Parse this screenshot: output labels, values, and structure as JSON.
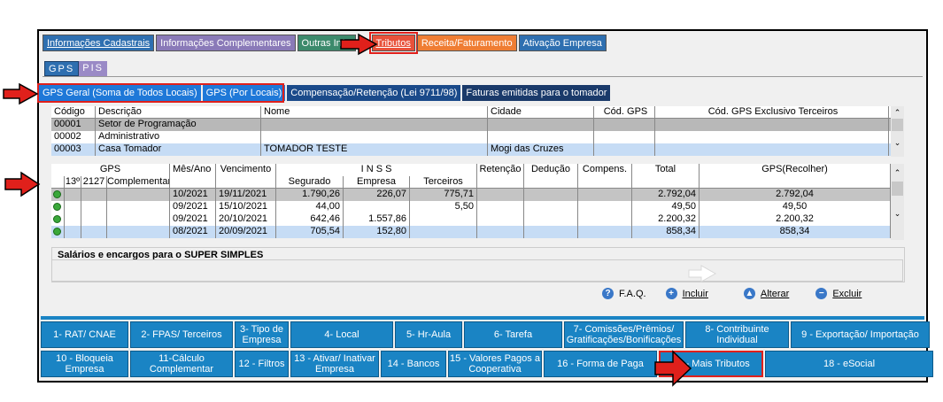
{
  "tabs": [
    {
      "label": "Informações Cadastrais",
      "style": "blue"
    },
    {
      "label": "Informações Complementares",
      "style": "purple"
    },
    {
      "label": "Outras Info",
      "style": "green"
    },
    {
      "label": "Tributos",
      "style": "active"
    },
    {
      "label": "Receita/Faturamento",
      "style": "orange"
    },
    {
      "label": "Ativação Empresa",
      "style": "blue"
    }
  ],
  "subtabs": {
    "gps": "GPS",
    "pis": "PIS"
  },
  "gps_tabs": [
    "GPS Geral (Soma de Todos Locais)",
    "GPS (Por Locais)",
    "Compensação/Retenção (Lei 9711/98)",
    "Faturas emitidas para o tomador"
  ],
  "locais": {
    "headers": [
      "Código",
      "Descrição",
      "Nome",
      "Cidade",
      "Cód. GPS",
      "Cód. GPS Exclusivo Terceiros"
    ],
    "rows": [
      [
        "00001",
        "Setor de Programação",
        "",
        "",
        "",
        ""
      ],
      [
        "00002",
        "Administrativo",
        "",
        "",
        "",
        ""
      ],
      [
        "00003",
        "Casa Tomador",
        "TOMADOR TESTE",
        "Mogi das Cruzes",
        "",
        ""
      ]
    ]
  },
  "gps_grid": {
    "group_gps": "GPS",
    "mes_ano": "Mês/Ano",
    "vencimento": "Vencimento",
    "group_inss": "I N S S",
    "retencao": "Retenção",
    "deducao": "Dedução",
    "compens": "Compens.",
    "total": "Total",
    "gps_recolher": "GPS(Recolher)",
    "sub_13": "13º",
    "sub_2127": "2127",
    "sub_complementar": "Complementar",
    "sub_segurado": "Segurado",
    "sub_empresa": "Empresa",
    "sub_terceiros": "Terceiros",
    "rows": [
      {
        "mes": "10/2021",
        "venc": "19/11/2021",
        "segurado": "1.790,26",
        "empresa": "226,07",
        "terceiros": "775,71",
        "total": "2.792,04",
        "recolher": "2.792,04"
      },
      {
        "mes": "09/2021",
        "venc": "15/10/2021",
        "segurado": "44,00",
        "empresa": "",
        "terceiros": "5,50",
        "total": "49,50",
        "recolher": "49,50"
      },
      {
        "mes": "09/2021",
        "venc": "20/10/2021",
        "segurado": "642,46",
        "empresa": "1.557,86",
        "terceiros": "",
        "total": "2.200,32",
        "recolher": "2.200,32"
      },
      {
        "mes": "08/2021",
        "venc": "20/09/2021",
        "segurado": "705,54",
        "empresa": "152,80",
        "terceiros": "",
        "total": "858,34",
        "recolher": "858,34"
      }
    ]
  },
  "salarios_label": "Salários e encargos para o SUPER SIMPLES",
  "actions": {
    "faq": "F.A.Q.",
    "incluir": "Incluir",
    "alterar": "Alterar",
    "excluir": "Excluir"
  },
  "buttons_row1": [
    "1- RAT/ CNAE",
    "2- FPAS/ Terceiros",
    "3- Tipo de Empresa",
    "4- Local",
    "5- Hr-Aula",
    "6- Tarefa",
    "7- Comissões/Prêmios/ Gratificações/Bonificações",
    "8- Contribuinte Individual",
    "9 - Exportação/ Importação"
  ],
  "buttons_row2": [
    "10 - Bloqueia Empresa",
    "11-Cálculo Complementar",
    "12 - Filtros",
    "13 - Ativar/ Inativar Empresa",
    "14 - Bancos",
    "15 - Valores Pagos a Cooperativa",
    "16 - Forma de Paga",
    "17 - Mais Tributos",
    "18 - eSocial"
  ]
}
